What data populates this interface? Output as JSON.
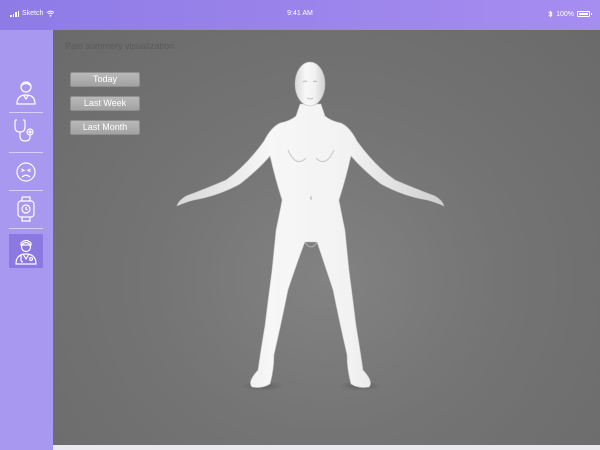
{
  "status_bar": {
    "carrier": "Sketch",
    "time": "9:41 AM",
    "battery": "100%"
  },
  "sidebar": {
    "items": [
      {
        "icon": "patient-icon",
        "active": false
      },
      {
        "icon": "stethoscope-icon",
        "active": false
      },
      {
        "icon": "pain-face-icon",
        "active": false
      },
      {
        "icon": "smartwatch-icon",
        "active": false
      },
      {
        "icon": "doctor-icon",
        "active": true
      }
    ]
  },
  "main": {
    "title": "Pain summery visualization",
    "buttons": [
      {
        "label": "Today"
      },
      {
        "label": "Last Week"
      },
      {
        "label": "Last Month"
      }
    ]
  },
  "colors": {
    "accent": "#a998ef",
    "accent_dark": "#8b78e0",
    "viewport_bg": "#747474",
    "button_bg": "#acacac"
  }
}
